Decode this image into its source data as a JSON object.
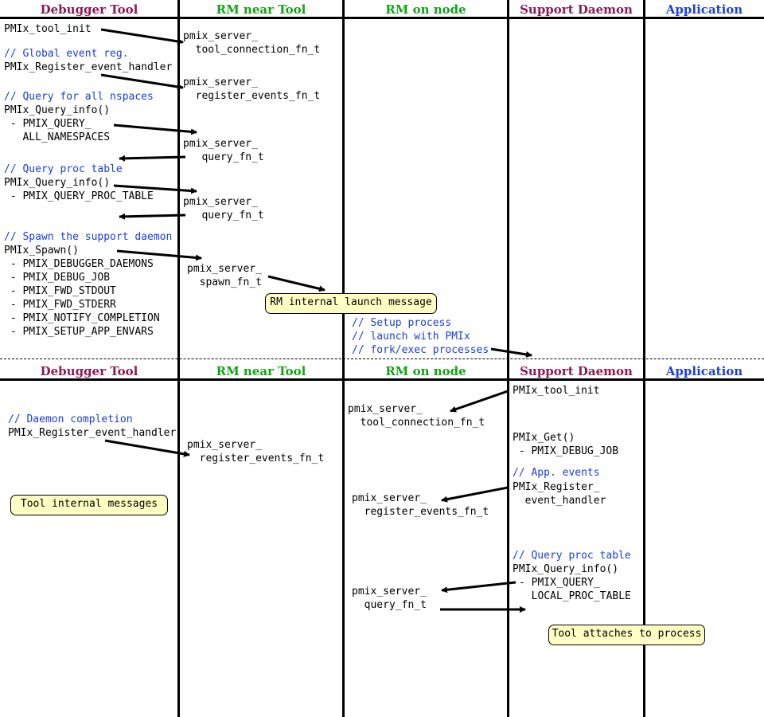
{
  "lanes": [
    "Debugger Tool",
    "RM near Tool",
    "RM on node",
    "Support Daemon",
    "Application"
  ],
  "top": {
    "tool": {
      "tool_init": "PMIx_tool_init",
      "c_global_event": "// Global event reg.",
      "register_event_handler": "PMIx_Register_event_handler",
      "c_query_nspaces": "// Query for all nspaces",
      "query_info_1": "PMIx_Query_info()",
      "pmix_query_1": " - PMIX_QUERY_",
      "all_namespaces": "   ALL_NAMESPACES",
      "c_query_proc": "// Query proc table",
      "query_info_2": "PMIx_Query_info()",
      "query_proc_table": " - PMIX_QUERY_PROC_TABLE",
      "c_spawn": "// Spawn the support daemon",
      "spawn": "PMIx_Spawn()",
      "debugger_daemons": " - PMIX_DEBUGGER_DAEMONS",
      "debug_job": " - PMIX_DEBUG_JOB",
      "fwd_stdout": " - PMIX_FWD_STDOUT",
      "fwd_stderr": " - PMIX_FWD_STDERR",
      "notify_completion": " - PMIX_NOTIFY_COMPLETION",
      "setup_app_envars": " - PMIX_SETUP_APP_ENVARS"
    },
    "rm_near": {
      "tc_1": "pmix_server_",
      "tc_2": "  tool_connection_fn_t",
      "re_1": "pmix_server_",
      "re_2": "  register_events_fn_t",
      "q1_1": "pmix_server_",
      "q1_2": "   query_fn_t",
      "q2_1": "pmix_server_",
      "q2_2": "   query_fn_t",
      "sp_1": "pmix_server_",
      "sp_2": "  spawn_fn_t"
    },
    "launch_note": "RM internal launch message",
    "rm_node": {
      "c_setup": "// Setup process",
      "c_launch": "// launch with PMIx",
      "c_fork": "// fork/exec processes"
    }
  },
  "bottom": {
    "tool": {
      "c_daemon_completion": "// Daemon completion",
      "register_event_handler": "PMIx_Register_event_handler"
    },
    "tool_note": "Tool internal messages",
    "rm_near": {
      "re_1": "pmix_server_",
      "re_2": "  register_events_fn_t"
    },
    "rm_node": {
      "tc_1": "pmix_server_",
      "tc_2": "  tool_connection_fn_t",
      "re_1": "pmix_server_",
      "re_2": "  register_events_fn_t",
      "q_1": "pmix_server_",
      "q_2": "  query_fn_t"
    },
    "daemon": {
      "tool_init": "PMIx_tool_init",
      "get": "PMIx_Get()",
      "debug_job": " - PMIX_DEBUG_JOB",
      "c_app_events": "// App. events",
      "register_1": "PMIx_Register_",
      "register_2": "  event_handler",
      "c_query_proc": "// Query proc table",
      "query_info": "PMIx_Query_info()",
      "pmix_query": "- PMIX_QUERY_",
      "local_proc_table": "  LOCAL_PROC_TABLE"
    },
    "attach_note": "Tool attaches to process"
  }
}
